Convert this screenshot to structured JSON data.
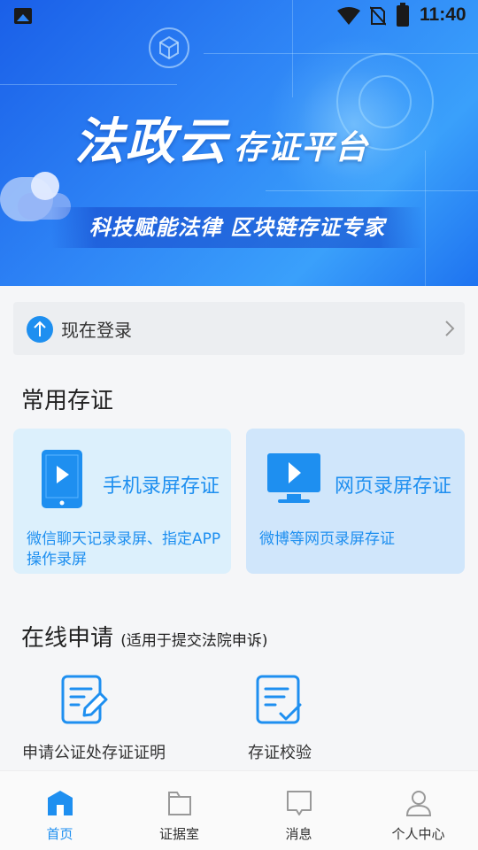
{
  "status_bar": {
    "time": "11:40"
  },
  "banner": {
    "title_main": "法政云",
    "title_secondary": "存证平台",
    "subtitle": "科技赋能法律 区块链存证专家"
  },
  "login": {
    "label": "现在登录"
  },
  "common_section": {
    "title": "常用存证",
    "cards": [
      {
        "title": "手机录屏存证",
        "desc": "微信聊天记录录屏、指定APP操作录屏",
        "icon": "phone-play-icon"
      },
      {
        "title": "网页录屏存证",
        "desc": "微博等网页录屏存证",
        "icon": "monitor-play-icon"
      }
    ]
  },
  "online_section": {
    "title": "在线申请",
    "note": "(适用于提交法院申诉)",
    "items": [
      {
        "label": "申请公证处存证证明",
        "icon": "document-edit-icon"
      },
      {
        "label": "存证校验",
        "icon": "document-check-icon"
      }
    ]
  },
  "tabbar": {
    "tabs": [
      {
        "label": "首页",
        "icon": "home-icon",
        "active": true
      },
      {
        "label": "证据室",
        "icon": "folder-icon",
        "active": false
      },
      {
        "label": "消息",
        "icon": "message-icon",
        "active": false
      },
      {
        "label": "个人中心",
        "icon": "person-icon",
        "active": false
      }
    ]
  },
  "colors": {
    "accent": "#1e8ff0",
    "banner_blue": "#2f86f6"
  }
}
